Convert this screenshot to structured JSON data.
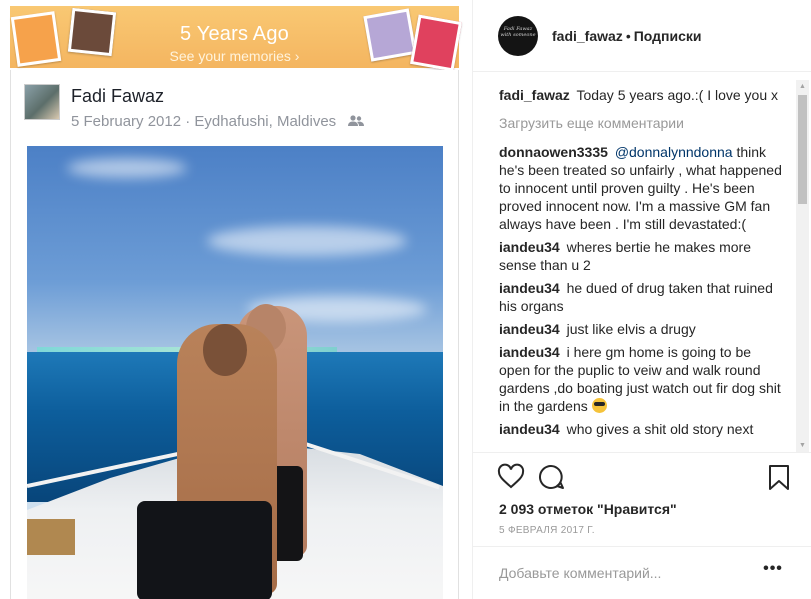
{
  "memory": {
    "title": "5 Years Ago",
    "subtitle": "See your memories ›"
  },
  "fb_post": {
    "author": "Fadi Fawaz",
    "date": "5 February 2012",
    "separator": "·",
    "location": "Eydhafushi, Maldives",
    "audience_icon": "friends-icon"
  },
  "header": {
    "username": "fadi_fawaz",
    "dot": "•",
    "follow_label": "Подписки",
    "avatar_text": "Fadi Fawaz with someone"
  },
  "comments": {
    "caption": {
      "user": "fadi_fawaz",
      "text": "Today 5 years ago.:( I love you x"
    },
    "load_more": "Загрузить еще комментарии",
    "items": [
      {
        "user": "donnaowen3335",
        "mention": "@donnalynndonna",
        "text": " think he's been treated so unfairly , what happened to innocent until proven guilty . He's been proved innocent now. I'm a massive GM fan always have been . I'm still devastated:("
      },
      {
        "user": "iandeu34",
        "text": "wheres bertie he makes more sense than u 2"
      },
      {
        "user": "iandeu34",
        "text": "he dued of drug taken that ruined his organs"
      },
      {
        "user": "iandeu34",
        "text": "just like elvis a drugy"
      },
      {
        "user": "iandeu34",
        "text": "i here gm home is going to be open for the puplic to veiw and walk round gardens ,do boating just watch out fir dog shit in the gardens"
      },
      {
        "user": "iandeu34",
        "text": "who gives a shit old story next"
      }
    ]
  },
  "actions": {
    "likes": "2 093 отметок \"Нравится\"",
    "date": "5 ФЕВРАЛЯ 2017 Г."
  },
  "add_comment": {
    "placeholder": "Добавьте комментарий...",
    "more": "•••"
  }
}
